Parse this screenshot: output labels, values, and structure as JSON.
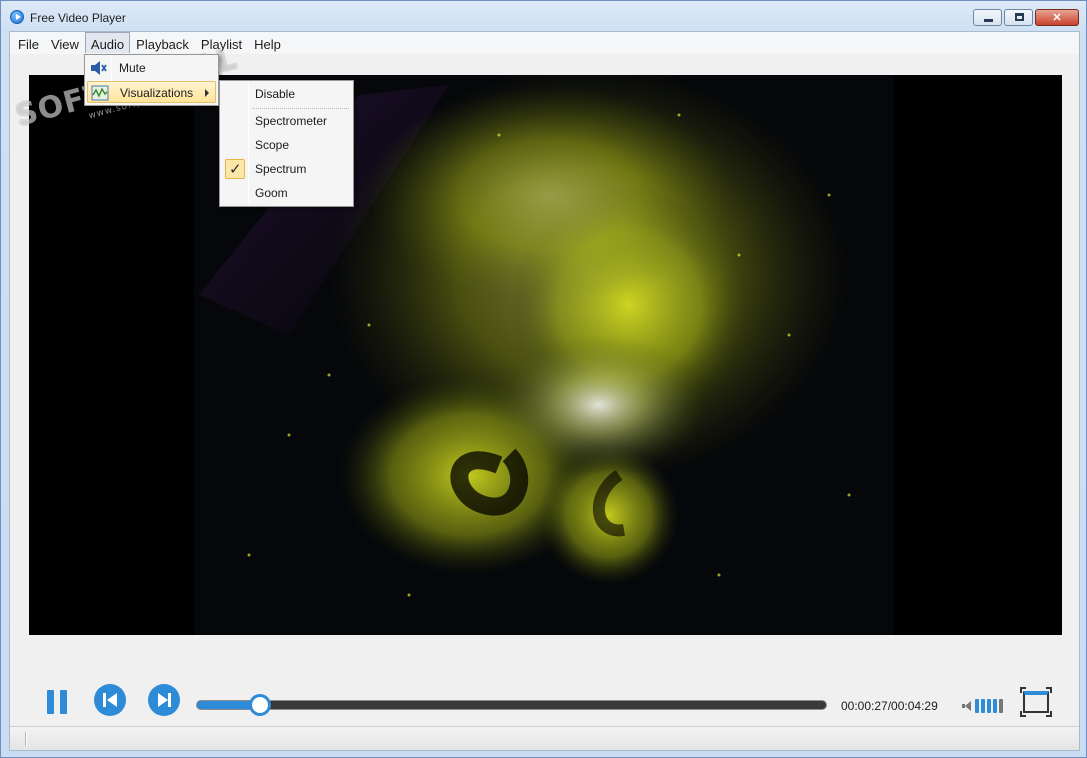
{
  "window": {
    "title": "Free Video Player"
  },
  "menubar": {
    "items": [
      "File",
      "View",
      "Audio",
      "Playback",
      "Playlist",
      "Help"
    ],
    "active": "Audio"
  },
  "audio_menu": {
    "mute": {
      "label": "Mute",
      "icon": "speaker-mute-icon"
    },
    "visualizations": {
      "label": "Visualizations",
      "icon": "visualization-icon"
    }
  },
  "visualizations_menu": {
    "items": [
      "Disable",
      "Spectrometer",
      "Scope",
      "Spectrum",
      "Goom"
    ],
    "checked": "Spectrum"
  },
  "watermark": {
    "main": "SOFTPORTAL",
    "sub": "www.softportal.com"
  },
  "playback": {
    "current_time": "00:00:27",
    "total_time": "00:04:29",
    "time_display": "00:00:27/00:04:29",
    "progress_fraction": 0.1,
    "volume_level_fraction": 0.8
  },
  "colors": {
    "accent": "#2d8bd7",
    "menu_highlight": "#ffe49a",
    "video_background": "#000000",
    "visualization": "#c8d21e"
  }
}
